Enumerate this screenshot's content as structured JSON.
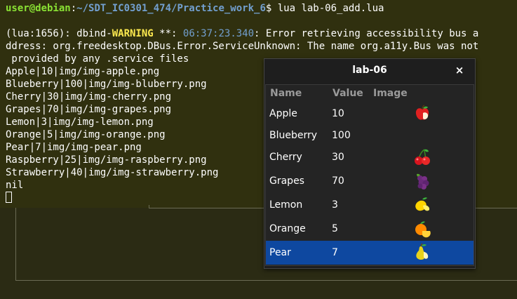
{
  "terminal": {
    "prompt_user": "user@debian",
    "prompt_sep": ":",
    "prompt_path": "~/SDT_IC0301_474/Practice_work_6",
    "prompt_symbol": "$ ",
    "command": "lua lab-06_add.lua",
    "warning_prefix": "(lua:1656): dbind-",
    "warning_label": "WARNING",
    "warning_mid": " **: ",
    "warning_time": "06:37:23.340",
    "warning_rest": ": Error retrieving accessibility bus a",
    "warning_line2": "ddress: org.freedesktop.DBus.Error.ServiceUnknown: The name org.a11y.Bus was not",
    "warning_line3": " provided by any .service files",
    "output_lines": [
      "Apple|10|img/img-apple.png",
      "Blueberry|100|img/img-bluberry.png",
      "Cherry|30|img/img-cherry.png",
      "Grapes|70|img/img-grapes.png",
      "Lemon|3|img/img-lemon.png",
      "Orange|5|img/img-orange.png",
      "Pear|7|img/img-pear.png",
      "Raspberry|25|img/img-raspberry.png",
      "Strawberry|40|img/img-strawberry.png",
      "nil"
    ]
  },
  "dialog": {
    "title": "lab-06",
    "close_glyph": "×",
    "columns": {
      "name": "Name",
      "value": "Value",
      "image": "Image"
    },
    "rows": [
      {
        "name": "Apple",
        "value": "10",
        "icon": "apple-icon",
        "selected": false
      },
      {
        "name": "Blueberry",
        "value": "100",
        "icon": "",
        "selected": false
      },
      {
        "name": "Cherry",
        "value": "30",
        "icon": "cherry-icon",
        "selected": false
      },
      {
        "name": "Grapes",
        "value": "70",
        "icon": "grapes-icon",
        "selected": false
      },
      {
        "name": "Lemon",
        "value": "3",
        "icon": "lemon-icon",
        "selected": false
      },
      {
        "name": "Orange",
        "value": "5",
        "icon": "orange-icon",
        "selected": false
      },
      {
        "name": "Pear",
        "value": "7",
        "icon": "pear-icon",
        "selected": true
      }
    ],
    "selection_color": "#0e48a0"
  }
}
